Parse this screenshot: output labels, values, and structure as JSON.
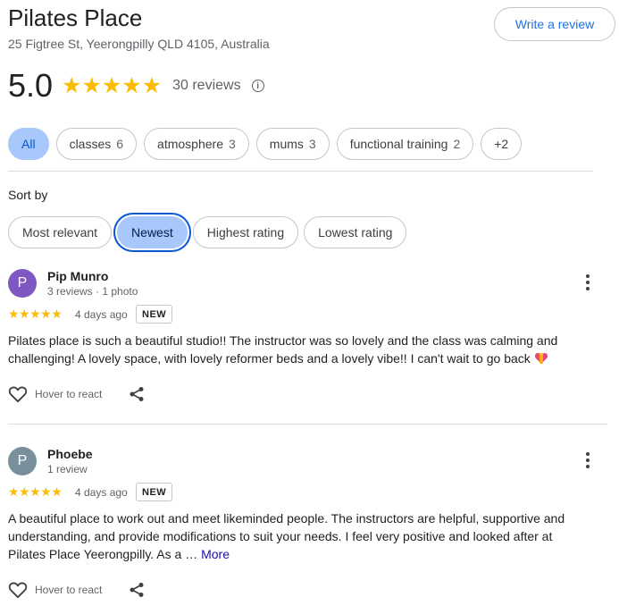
{
  "header": {
    "title": "Pilates Place",
    "address": "25 Figtree St, Yeerongpilly QLD 4105, Australia",
    "write_review_label": "Write a review"
  },
  "summary": {
    "rating": "5.0",
    "stars": "★★★★★",
    "review_count": "30 reviews",
    "info_symbol": "i"
  },
  "topics": [
    {
      "label": "All",
      "count": "",
      "selected": true
    },
    {
      "label": "classes",
      "count": "6"
    },
    {
      "label": "atmosphere",
      "count": "3"
    },
    {
      "label": "mums",
      "count": "3"
    },
    {
      "label": "functional training",
      "count": "2"
    },
    {
      "label": "+2",
      "count": ""
    }
  ],
  "sort": {
    "label": "Sort by",
    "options": [
      "Most relevant",
      "Newest",
      "Highest rating",
      "Lowest rating"
    ],
    "selected": "Newest"
  },
  "reviews": [
    {
      "avatar_letter": "P",
      "avatar_color": "#7e57c2",
      "name": "Pip Munro",
      "meta": "3 reviews · 1 photo",
      "stars": "★★★★★",
      "date": "4 days ago",
      "badge": "NEW",
      "text": "Pilates place is such a beautiful studio!! The instructor was so lovely and the class was calming and challenging! A lovely space, with lovely reformer beds and a lovely vibe!! I can't wait to go back ",
      "more_label": "",
      "react_label": "Hover to react",
      "emoji_icon": "heart-gift-emoji"
    },
    {
      "avatar_letter": "P",
      "avatar_color": "#78909c",
      "name": "Phoebe",
      "meta": "1 review",
      "stars": "★★★★★",
      "date": "4 days ago",
      "badge": "NEW",
      "text": "A beautiful place to work out and meet likeminded people. The instructors are helpful, supportive and understanding, and provide modifications to suit your needs. I feel very positive and looked after at Pilates Place Yeerongpilly. As a … ",
      "more_label": "More",
      "react_label": "Hover to react"
    }
  ]
}
